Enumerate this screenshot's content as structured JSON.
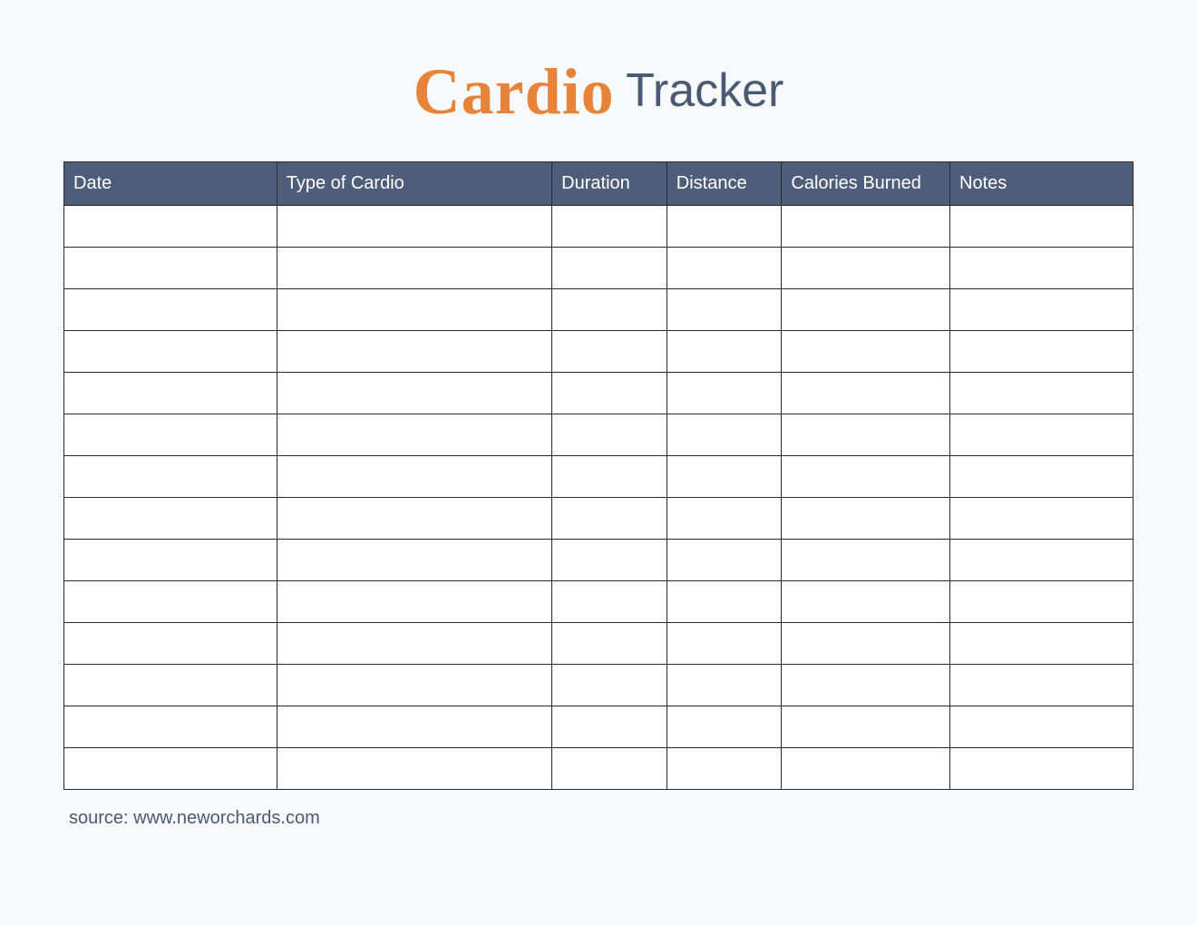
{
  "title": {
    "script": "Cardio",
    "plain": "Tracker"
  },
  "table": {
    "headers": [
      "Date",
      "Type of Cardio",
      "Duration",
      "Distance",
      "Calories Burned",
      "Notes"
    ],
    "row_count": 14
  },
  "footer": {
    "source": "source: www.neworchards.com"
  },
  "colors": {
    "accent_orange": "#e8833a",
    "header_bg": "#4e5e7a",
    "text_slate": "#4a5a75",
    "page_bg": "#f7f9fa"
  }
}
